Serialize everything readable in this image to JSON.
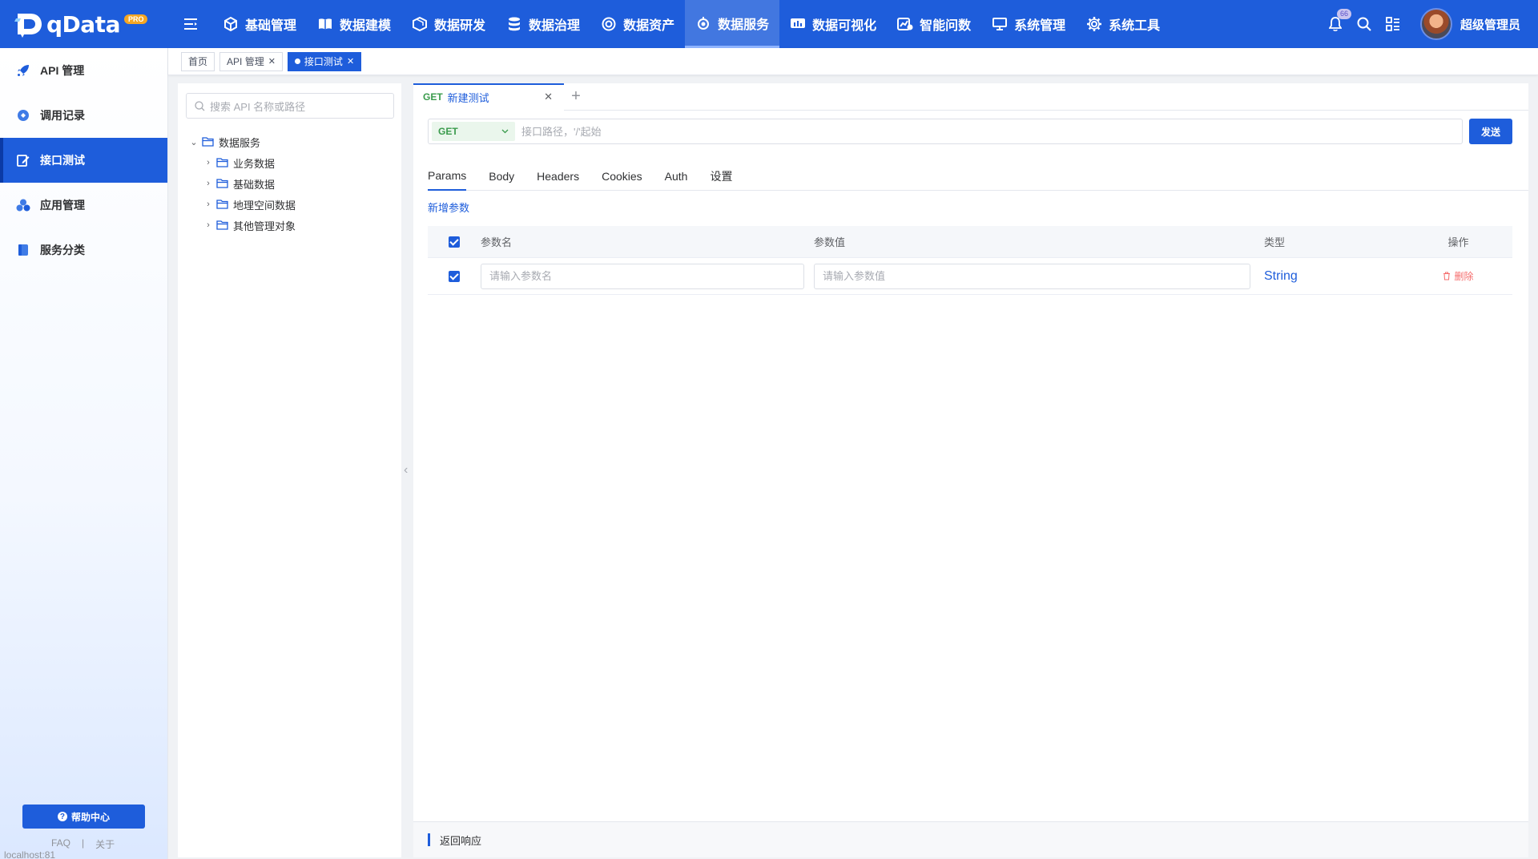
{
  "brand": {
    "name": "qData",
    "badge": "PRO"
  },
  "nav": {
    "items": [
      {
        "label": "基础管理",
        "icon": "cube-icon"
      },
      {
        "label": "数据建模",
        "icon": "book-icon"
      },
      {
        "label": "数据研发",
        "icon": "box-icon"
      },
      {
        "label": "数据治理",
        "icon": "database-icon"
      },
      {
        "label": "数据资产",
        "icon": "target-icon"
      },
      {
        "label": "数据服务",
        "icon": "service-icon",
        "active": true
      },
      {
        "label": "数据可视化",
        "icon": "chart-icon"
      },
      {
        "label": "智能问数",
        "icon": "ai-icon"
      },
      {
        "label": "系统管理",
        "icon": "monitor-icon"
      },
      {
        "label": "系统工具",
        "icon": "gear-icon"
      }
    ],
    "notification_count": "66",
    "user_name": "超级管理员"
  },
  "sidebar": {
    "items": [
      {
        "label": "API 管理",
        "icon": "rocket-icon"
      },
      {
        "label": "调用记录",
        "icon": "record-icon"
      },
      {
        "label": "接口测试",
        "icon": "edit-icon",
        "active": true
      },
      {
        "label": "应用管理",
        "icon": "apps-icon"
      },
      {
        "label": "服务分类",
        "icon": "category-icon"
      }
    ],
    "help_label": "帮助中心",
    "faq_label": "FAQ",
    "divider": "|",
    "about_label": "关于",
    "status_url": "localhost:81"
  },
  "tags": [
    {
      "label": "首页"
    },
    {
      "label": "API 管理",
      "closable": true
    },
    {
      "label": "接口测试",
      "closable": true,
      "active": true
    }
  ],
  "tree": {
    "search_placeholder": "搜索 API 名称或路径",
    "root": "数据服务",
    "children": [
      "业务数据",
      "基础数据",
      "地理空间数据",
      "其他管理对象"
    ]
  },
  "request": {
    "tab": {
      "method": "GET",
      "name": "新建测试"
    },
    "method": "GET",
    "url_placeholder": "接口路径，'/'起始",
    "send_label": "发送",
    "param_tabs": [
      "Params",
      "Body",
      "Headers",
      "Cookies",
      "Auth",
      "设置"
    ],
    "add_param_label": "新增参数",
    "table": {
      "headers": {
        "name": "参数名",
        "value": "参数值",
        "type": "类型",
        "op": "操作"
      },
      "row": {
        "name_placeholder": "请输入参数名",
        "value_placeholder": "请输入参数值",
        "type": "String",
        "delete_label": "删除"
      }
    },
    "response_label": "返回响应"
  },
  "colors": {
    "primary": "#1e5ddb",
    "get_method": "#3a9b4c",
    "danger": "#f56c6c"
  }
}
